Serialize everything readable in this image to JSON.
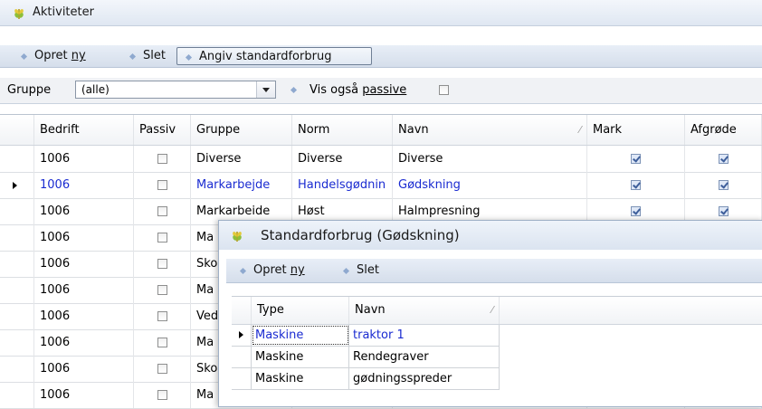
{
  "window": {
    "title": "Aktiviteter",
    "icon": "wheat-icon"
  },
  "toolbar": {
    "create_prefix": "Opret ",
    "create_access": "ny",
    "delete_label": "Slet",
    "standard_label": "Angiv standardforbrug"
  },
  "filter": {
    "group_label": "Gruppe",
    "group_value": "(alle)",
    "show_passive_prefix": "Vis også ",
    "show_passive_access": "passive",
    "show_passive_checked": false
  },
  "grid": {
    "columns": [
      "Bedrift",
      "Passiv",
      "Gruppe",
      "Norm",
      "Navn",
      "Mark",
      "Afgrøde"
    ],
    "rows": [
      {
        "bedrift": "1006",
        "passiv": false,
        "gruppe": "Diverse",
        "norm": "Diverse",
        "navn": "Diverse",
        "mark": true,
        "afgrode": true
      },
      {
        "bedrift": "1006",
        "passiv": false,
        "gruppe": "Markarbejde",
        "norm": "Handelsgødnin",
        "navn": "Gødskning",
        "mark": true,
        "afgrode": true
      },
      {
        "bedrift": "1006",
        "passiv": false,
        "gruppe": "Markarbeide",
        "norm": "Høst",
        "navn": "Halmpresning",
        "mark": true,
        "afgrode": true
      },
      {
        "bedrift": "1006",
        "passiv": false,
        "gruppe": "Ma",
        "norm": "",
        "navn": "",
        "mark": null,
        "afgrode": null
      },
      {
        "bedrift": "1006",
        "passiv": false,
        "gruppe": "Sko",
        "norm": "",
        "navn": "",
        "mark": null,
        "afgrode": null
      },
      {
        "bedrift": "1006",
        "passiv": false,
        "gruppe": "Ma",
        "norm": "",
        "navn": "",
        "mark": null,
        "afgrode": null
      },
      {
        "bedrift": "1006",
        "passiv": false,
        "gruppe": "Ved",
        "norm": "",
        "navn": "",
        "mark": null,
        "afgrode": null
      },
      {
        "bedrift": "1006",
        "passiv": false,
        "gruppe": "Ma",
        "norm": "",
        "navn": "",
        "mark": null,
        "afgrode": null
      },
      {
        "bedrift": "1006",
        "passiv": false,
        "gruppe": "Sko",
        "norm": "",
        "navn": "",
        "mark": null,
        "afgrode": null
      },
      {
        "bedrift": "1006",
        "passiv": false,
        "gruppe": "Ma",
        "norm": "",
        "navn": "",
        "mark": null,
        "afgrode": null
      }
    ],
    "selected_row": 1
  },
  "dialog": {
    "title": "Standardforbrug (Gødskning)",
    "icon": "wheat-icon",
    "toolbar": {
      "create_prefix": "Opret ",
      "create_access": "ny",
      "delete_label": "Slet"
    },
    "columns": [
      "Type",
      "Navn"
    ],
    "rows": [
      {
        "type": "Maskine",
        "navn": "traktor 1"
      },
      {
        "type": "Maskine",
        "navn": "Rendegraver"
      },
      {
        "type": "Maskine",
        "navn": "gødningsspreder"
      }
    ],
    "selected_row": 0
  },
  "colors": {
    "selected_text": "#1a2bd1",
    "toolbar_bg": "#dfe7f2",
    "accent_icon": "#c9b52f"
  }
}
